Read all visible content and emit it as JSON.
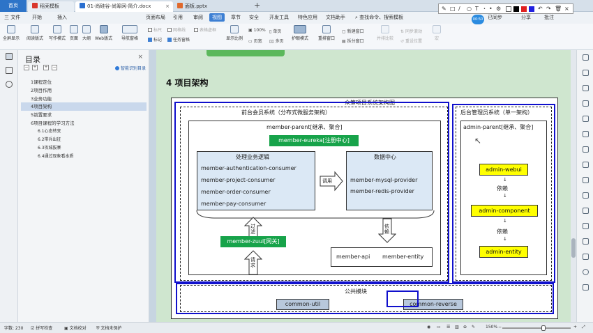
{
  "tabs": {
    "home": "首页",
    "t1": "稻壳模板",
    "t2": "01-尚硅谷-尚筹网-简介.docx",
    "t3": "面板.pptx",
    "plus": "+"
  },
  "annotation_tools": {
    "tools": [
      "✎",
      "□",
      "/",
      "○",
      "T",
      "•",
      "•"
    ]
  },
  "avatar": "00:50",
  "menu": {
    "file": "三 文件",
    "items": [
      "开始",
      "插入",
      "页面布局",
      "引用",
      "审阅",
      "视图",
      "章节",
      "安全",
      "开发工具",
      "特色应用",
      "文档助手"
    ],
    "search": "查找命令、搜索模板",
    "right": [
      "已同步",
      "分享",
      "批注"
    ]
  },
  "toolbar": {
    "big": [
      "全屏显示",
      "阅读版式",
      "写作模式",
      "页面",
      "大纲",
      "Web版式",
      "导航窗格"
    ],
    "checks": [
      "标尺",
      "网格线",
      "表格虚框",
      "标记",
      "任务窗格"
    ],
    "zoom": [
      "显示比例",
      "100%",
      "页宽",
      "单页",
      "多页"
    ],
    "eye": "护眼模式",
    "win": [
      "重排窗口",
      "新建窗口",
      "拆分窗口",
      "并排比较",
      "同步滚动",
      "重设位置",
      "宏"
    ]
  },
  "toc": {
    "title": "目录",
    "smart": "智能识别目录",
    "items": [
      "1课程定位",
      "2项目作用",
      "3业务功能",
      "4项目架构",
      "5前置要求",
      "6项目课程的学习方法",
      "6.1心态转变",
      "6.2带兵出征",
      "6.3攻城拔寨",
      "6.4通过现象看本质"
    ]
  },
  "doc": {
    "heading": "4   项目架构",
    "diagram": {
      "title": "众筹项目系统架构图",
      "front_title": "前台会员系统（分布式微服务架构）",
      "member_parent": "member-parent[继承、聚合]",
      "eureka": "member-eureka[注册中心]",
      "biz_title": "处理业务逻辑",
      "consumers": [
        "member-authentication-consumer",
        "member-project-consumer",
        "member-order-consumer",
        "member-pay-consumer"
      ],
      "call": "调用",
      "data_title": "数据中心",
      "providers": [
        "member-mysql-provider",
        "member-redis-provider"
      ],
      "filter": "过滤",
      "depend": "依赖",
      "zuul": "member-zuul[网关]",
      "request": "请求",
      "api": "member-api",
      "entity": "member-entity",
      "admin_title": "后台管理员系统（单一架构）",
      "admin_parent": "admin-parent[继承、聚合]",
      "webui": "admin-webui",
      "depend1": "依赖",
      "component": "admin-component",
      "depend2": "依赖",
      "admin_entity": "admin-entity",
      "common_title": "公共模块",
      "common_util": "common-util",
      "common_reverse": "common-reverse"
    }
  },
  "status": {
    "words": "字数: 230",
    "spell": "拼写检查",
    "proof": "文档校对",
    "protect": "文档未保护",
    "zoom": "150%"
  },
  "colors": {
    "tab_blue": "#2d74c8",
    "green": "#17a34a",
    "yellow": "#ffff00",
    "hl_blue": "#1010cc"
  }
}
